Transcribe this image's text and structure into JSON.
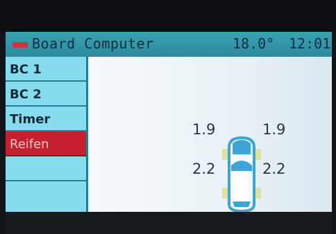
{
  "header": {
    "title": "Board Computer",
    "temperature": "18.0°",
    "time": "12:01"
  },
  "menu": {
    "items": [
      {
        "label": "BC 1",
        "active": false
      },
      {
        "label": "BC 2",
        "active": false
      },
      {
        "label": "Timer",
        "active": false
      },
      {
        "label": "Reifen",
        "active": true
      },
      {
        "label": "",
        "active": false
      },
      {
        "label": "",
        "active": false
      }
    ]
  },
  "tyres": {
    "front_left": "1.9",
    "front_right": "1.9",
    "rear_left": "2.2",
    "rear_right": "2.2"
  },
  "colors": {
    "header": "#2a8b9c",
    "menu": "#86dced",
    "active": "#c6202e",
    "car_body": "#3aa5d6",
    "tyre_indicator": "#e3e29a"
  }
}
